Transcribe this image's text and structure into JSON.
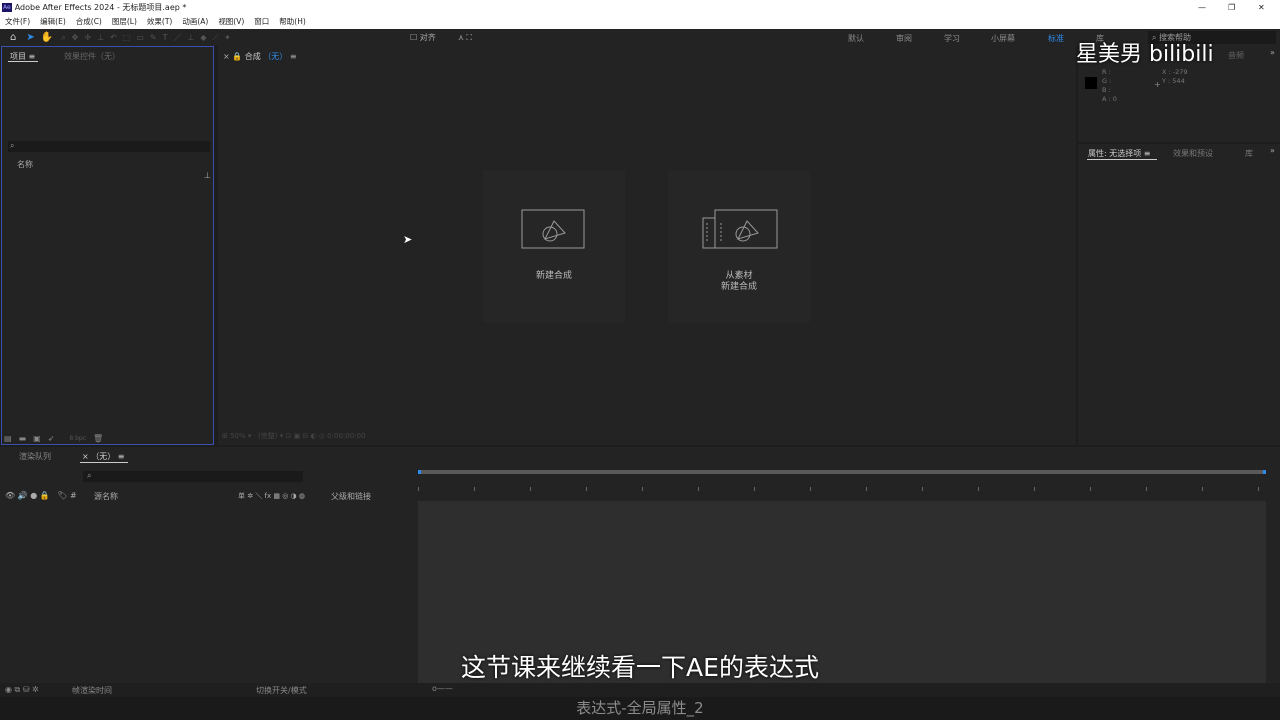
{
  "window": {
    "title": "Adobe After Effects 2024 - 无标题项目.aep *",
    "app_icon": "Ae"
  },
  "menu": [
    "文件(F)",
    "编辑(E)",
    "合成(C)",
    "图层(L)",
    "效果(T)",
    "动画(A)",
    "视图(V)",
    "窗口",
    "帮助(H)"
  ],
  "toolbar": {
    "snap_label": "对齐",
    "workspaces": [
      "默认",
      "审阅",
      "学习",
      "小屏幕",
      "标准",
      "库"
    ],
    "active_workspace": "标准",
    "search_placeholder": "搜索帮助"
  },
  "project_panel": {
    "tab": "项目",
    "tab2": "效果控件（无）",
    "column_name": "名称",
    "bpc": "8 bpc"
  },
  "comp_panel": {
    "tab": "合成",
    "tab_value": "（无）",
    "new_comp": "新建合成",
    "from_footage_1": "从素材",
    "from_footage_2": "新建合成"
  },
  "info_panel": {
    "tab_audio": "音频",
    "r": "R :",
    "g": "G :",
    "b": "B :",
    "a": "A : 0",
    "x": "X : -279",
    "y": "Y : 544"
  },
  "props_panel": {
    "tab": "属性: 无选择项",
    "tab2": "效果和预设",
    "tab3": "库"
  },
  "timeline": {
    "tab1": "渲染队列",
    "tab2": "（无）",
    "source_name": "源名称",
    "switches": "单 ✲ ＼ fx ▦ ◎ ◑ ◍",
    "parent": "父级和链接",
    "frame_render": "帧渲染时间",
    "toggle": "切换开关/模式"
  },
  "overlay": {
    "subtitle": "这节课来继续看一下AE的表达式",
    "caption": "表达式-全局属性_2",
    "watermark": "星美男 bilibili"
  },
  "colors": {
    "accent": "#2d8ceb",
    "panel_border": "#3a4fb0"
  }
}
